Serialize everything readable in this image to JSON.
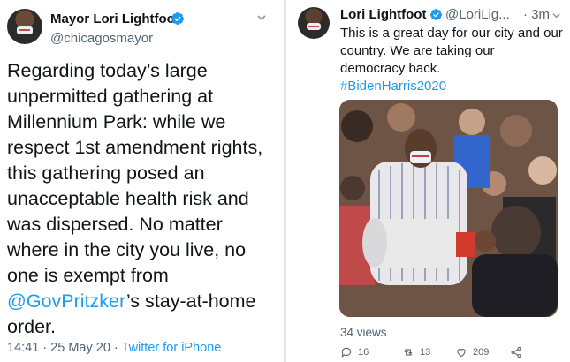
{
  "left_tweet": {
    "author_name": "Mayor Lori Lightfoot",
    "handle": "@chicagosmayor",
    "text_before_mention": "Regarding today’s large unpermitted gathering at Millennium Park: while we respect 1st amendment rights, this gathering posed an unacceptable health risk and was dispersed. No matter where in the city you live, no one is exempt from ",
    "mention": "@GovPritzker",
    "text_after_mention": "’s stay-at-home order.",
    "timestamp": "14:41 · 25 May 20 · ",
    "source": "Twitter for iPhone",
    "icons": [
      "verified-badge-icon",
      "chevron-down-icon"
    ]
  },
  "right_tweet": {
    "author_name": "Lori Lightfoot",
    "handle": "@LoriLig...",
    "time_ago": "· 3m",
    "text": "This is a great day for our city and our country. We are taking our democracy back.",
    "hashtag": "#BidenHarris2020",
    "views": "34 views",
    "actions": {
      "replies": "16",
      "retweets": "13",
      "likes": "209"
    },
    "icons": [
      "verified-badge-icon",
      "chevron-down-icon",
      "reply-icon",
      "retweet-icon",
      "like-icon",
      "share-icon"
    ]
  },
  "colors": {
    "link_blue": "#1d9bf0",
    "text_primary": "#0f1419",
    "text_secondary": "#536471",
    "verified_blue": "#1d9bf0"
  }
}
